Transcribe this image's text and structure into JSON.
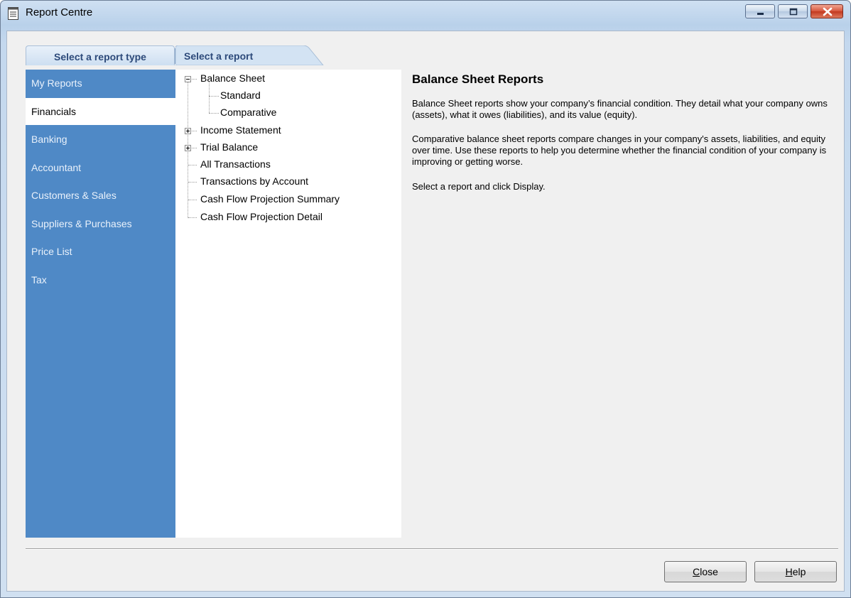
{
  "window": {
    "title": "Report Centre"
  },
  "tabs": {
    "report_type": "Select a report type",
    "report": "Select a report"
  },
  "sidebar": {
    "items": [
      {
        "label": "My Reports"
      },
      {
        "label": "Financials",
        "selected": true
      },
      {
        "label": "Banking"
      },
      {
        "label": "Accountant"
      },
      {
        "label": "Customers & Sales"
      },
      {
        "label": "Suppliers & Purchases"
      },
      {
        "label": "Price List"
      },
      {
        "label": "Tax"
      }
    ]
  },
  "tree": {
    "balance_sheet": "Balance Sheet",
    "standard": "Standard",
    "comparative": "Comparative",
    "income_statement": "Income Statement",
    "trial_balance": "Trial Balance",
    "all_transactions": "All Transactions",
    "transactions_by_account": "Transactions by Account",
    "cash_flow_summary": "Cash Flow Projection Summary",
    "cash_flow_detail": "Cash Flow Projection Detail"
  },
  "description": {
    "heading": "Balance Sheet Reports",
    "para1": "Balance Sheet reports show your company’s financial condition. They detail what your company owns (assets), what it owes (liabilities), and its value (equity).",
    "para2": "Comparative balance sheet reports compare changes in your company's assets, liabilities, and equity over time. Use these reports to help you determine whether the financial condition of your company is improving or getting worse.",
    "para3": "Select a report and click Display."
  },
  "buttons": {
    "close_accel": "C",
    "close_rest": "lose",
    "help_accel": "H",
    "help_rest": "elp"
  },
  "colors": {
    "sidebar_bg": "#4f89c6",
    "tab_text": "#2d4a7a",
    "close_button": "#c2381f"
  }
}
